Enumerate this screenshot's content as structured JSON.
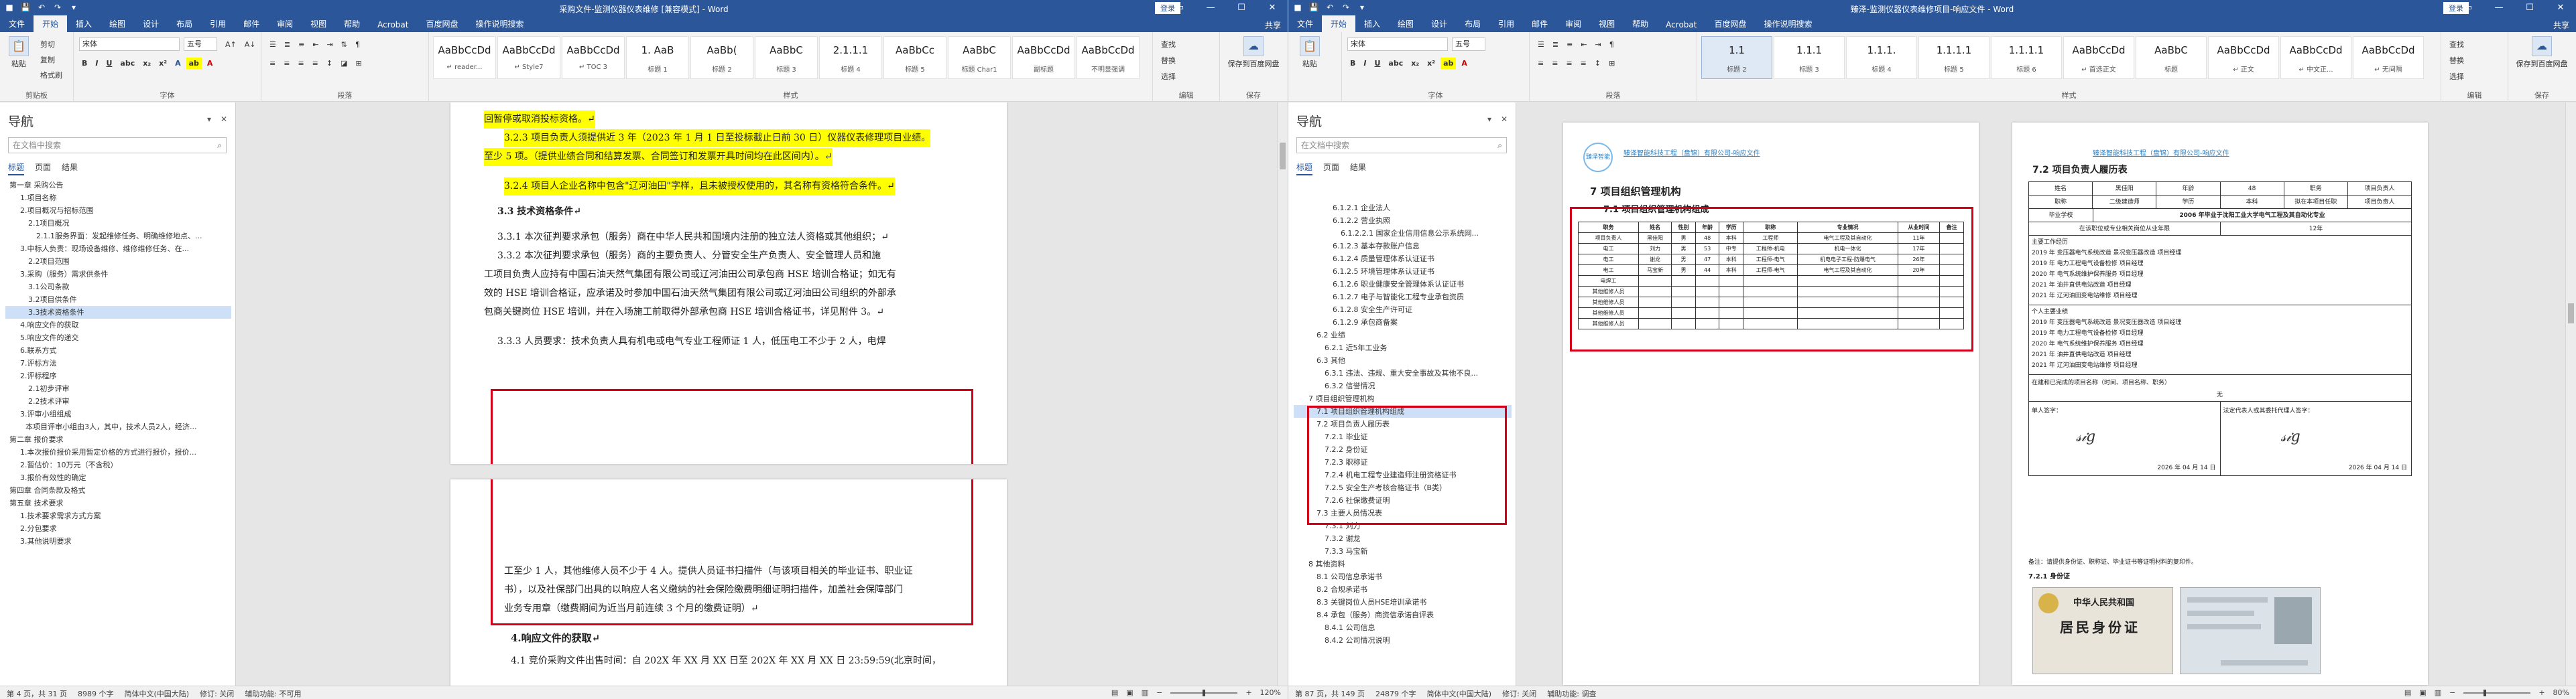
{
  "colors": {
    "word_blue": "#2b579a",
    "highlight": "#ffff00",
    "annotation_red": "#d4001a"
  },
  "left": {
    "title": "采购文件-监测仪器仪表维修 [兼容模式] - Word",
    "login": "登录",
    "share": "共享",
    "tabs": [
      "文件",
      "开始",
      "插入",
      "绘图",
      "设计",
      "布局",
      "引用",
      "邮件",
      "审阅",
      "视图",
      "帮助",
      "Acrobat",
      "百度网盘",
      "操作说明搜索"
    ],
    "ribbon": {
      "paste": "粘贴",
      "cut": "剪切",
      "copy": "复制",
      "format_painter": "格式刷",
      "clipboard": "剪贴板",
      "font_name": "宋体",
      "font_size": "五号",
      "font": "字体",
      "paragraph": "段落",
      "styles_label": "样式",
      "find": "查找",
      "replace": "替换",
      "select": "选择",
      "editing": "编辑",
      "save_baidu": "保存到百度网盘",
      "save_group": "保存",
      "styles": [
        {
          "prev": "AaBbCcDd",
          "name": "↵ reader..."
        },
        {
          "prev": "AaBbCcDd",
          "name": "↵ Style7"
        },
        {
          "prev": "AaBbCcDd",
          "name": "↵ TOC 3"
        },
        {
          "prev": "1. AaB",
          "name": "标题 1"
        },
        {
          "prev": "AaBb(",
          "name": "标题 2"
        },
        {
          "prev": "AaBbC",
          "name": "标题 3"
        },
        {
          "prev": "2.1.1.1",
          "name": "标题 4"
        },
        {
          "prev": "AaBbCc",
          "name": "标题 5"
        },
        {
          "prev": "AaBbC",
          "name": "标题 Char1"
        },
        {
          "prev": "AaBbCcDd",
          "name": "副标题"
        },
        {
          "prev": "AaBbCcDd",
          "name": "不明显强调"
        }
      ]
    },
    "nav": {
      "title": "导航",
      "search_placeholder": "在文档中搜索",
      "tabs": [
        "标题",
        "页面",
        "结果"
      ],
      "items": [
        "第一章 采购公告",
        "1.项目名称",
        "2.项目概况与招标范围",
        "2.1项目概况",
        "2.1.1服务界面：发起维修任务、明确维修地点、...",
        "3.中标人负责：现场设备维修、维修维修任务、在...",
        "2.2项目范围",
        "3.采购（服务）需求供条件",
        "3.1公司条款",
        "3.2项目供条件",
        "3.3技术资格条件",
        "4.响应文件的获取",
        "5.响应文件的递交",
        "6.联系方式",
        "7.评标方法",
        "2.评标程序",
        "2.1初步评审",
        "2.2技术评审",
        "3.评审小组组成",
        "本项目评审小组由3人，其中，技术人员2人，经济...",
        "第二章 报价要求",
        "1.本次报价报价采用暂定价格的方式进行报价，报价...",
        "2.暂估价：10万元（不含税）",
        "3.报价有效性的确定",
        "第四章 合同条款及格式",
        "第五章 技术要求",
        "1.技术要求需求方式方案",
        "2.分包要求",
        "3.其他说明要求"
      ]
    },
    "doc": {
      "lines": [
        "回暂停或取消投标资格。↵",
        "3.2.3 项目负责人须提供近 3 年（2023 年 1 月 1 日至投标截止日前 30 日）仪器仪表修理项目业绩。",
        "至少 5 项。（提供业绩合同和结算发票、合同签订和发票开具时间均在此区间内）。↵",
        "3.2.4 项目人企业名称中包含\"辽河油田\"字样，且未被授权使用的，其名称有资格符合条件。↵",
        "3.3 技术资格条件↵",
        "3.3.1 本次征判要求承包（服务）商在中华人民共和国境内注册的独立法人资格或其他组织；↵",
        "3.3.2 本次征判要求承包（服务）商的主要负责人、分管安全生产负责人、安全管理人员和施",
        "工项目负责人应持有中国石油天然气集团有限公司或辽河油田公司承包商 HSE 培训合格证；如无有",
        "效的 HSE 培训合格证，应承诺及时参加中国石油天然气集团有限公司或辽河油田公司组织的外部承",
        "包商关键岗位 HSE 培训，并在入场施工前取得外部承包商 HSE 培训合格证书，详见附件 3。↵",
        "3.3.3 人员要求：技术负责人具有机电或电气专业工程师证 1 人，低压电工不少于 2 人，电焊"
      ],
      "lines2": [
        "工至少 1 人，其他维修人员不少于 4 人。提供人员证书扫描件（与该项目相关的毕业证书、职业证",
        "书），以及社保部门出具的以响应人名义缴纳的社会保险缴费明细证明扫描件，加盖社会保障部门",
        "业务专用章（缴费期间为近当月前连续 3 个月的缴费证明）↵",
        "4.响应文件的获取↵",
        "4.1 竞价采购文件出售时间：自 202X 年 XX 月 XX 日至 202X 年 XX 月 XX 日 23:59:59(北京时间，"
      ]
    },
    "status": {
      "page": "第 4 页，共 31 页",
      "words": "8989 个字",
      "lang": "简体中文(中国大陆)",
      "track": "修订: 关闭",
      "access": "辅助功能: 不可用",
      "zoom": "120%"
    }
  },
  "right": {
    "title": "臻泽-监测仪器仪表维修项目-响应文件 - Word",
    "login": "登录",
    "share": "共享",
    "tabs": [
      "文件",
      "开始",
      "插入",
      "绘图",
      "设计",
      "布局",
      "引用",
      "邮件",
      "审阅",
      "视图",
      "帮助",
      "Acrobat",
      "百度网盘",
      "操作说明搜索"
    ],
    "ribbon": {
      "paste": "粘贴",
      "font_name": "宋体",
      "font_size": "五号",
      "font": "字体",
      "paragraph": "段落",
      "styles_label": "样式",
      "find": "查找",
      "replace": "替换",
      "select": "选择",
      "editing": "编辑",
      "save_baidu": "保存到百度网盘",
      "save_group": "保存",
      "styles": [
        {
          "prev": "1.1",
          "name": "标题 2"
        },
        {
          "prev": "1.1.1",
          "name": "标题 3"
        },
        {
          "prev": "1.1.1.",
          "name": "标题 4"
        },
        {
          "prev": "1.1.1.1",
          "name": "标题 5"
        },
        {
          "prev": "1.1.1.1",
          "name": "标题 6"
        },
        {
          "prev": "AaBbCcDd",
          "name": "↵ 首选正文"
        },
        {
          "prev": "AaBbC",
          "name": "标题"
        },
        {
          "prev": "AaBbCcDd",
          "name": "↵ 正文"
        },
        {
          "prev": "AaBbCcDd",
          "name": "↵ 中文正..."
        },
        {
          "prev": "AaBbCcDd",
          "name": "↵ 无间隔"
        }
      ]
    },
    "nav": {
      "title": "导航",
      "search_placeholder": "在文档中搜索",
      "tabs": [
        "标题",
        "页面",
        "结果"
      ],
      "items": [
        "6.1.2.1 企业法人",
        "6.1.2.2 营业执照",
        "6.1.2.2.1 国家企业信用信息公示系统网...",
        "6.1.2.3 基本存款账户信息",
        "6.1.2.4 质量管理体系认证证书",
        "6.1.2.5 环境管理体系认证证书",
        "6.1.2.6 职业健康安全管理体系认证证书",
        "6.1.2.7 电子与智能化工程专业承包资质",
        "6.1.2.8 安全生产许可证",
        "6.1.2.9 承包商备案",
        "6.2 业绩",
        "6.2.1 近5年工业务",
        "6.3 其他",
        "6.3.1 违法、违规、重大安全事故及其他不良...",
        "6.3.2 信誉情况",
        "7 项目组织管理机构",
        "7.1 项目组织管理机构组成",
        "7.2 项目负责人履历表",
        "7.2.1 毕业证",
        "7.2.2 身份证",
        "7.2.3 职称证",
        "7.2.4 机电工程专业建造师注册资格证书",
        "7.2.5 安全生产考核合格证书（B类）",
        "7.2.6 社保缴费证明",
        "7.3 主要人员情况表",
        "7.3.1 刘力",
        "7.3.2 谢龙",
        "7.3.3 马宝新",
        "8 其他资料",
        "8.1 公司信息承诺书",
        "8.2 合规承诺书",
        "8.3 关键岗位人员HSE培训承诺书",
        "8.4 承包（服务）商资信承诺自评表",
        "8.4.1 公司信息",
        "8.4.2 公司情况说明"
      ]
    },
    "page1": {
      "header": "臻泽智能科技工程（盘锦）有限公司-响应文件",
      "h7": "7  项目组织管理机构",
      "h71": "7.1  项目组织管理机构组成",
      "table_headers": [
        "职务",
        "姓名",
        "性别",
        "年龄",
        "学历",
        "职称",
        "专业情况",
        "从业时间",
        "备注"
      ],
      "rows": [
        [
          "项目负责人",
          "黑佳阳",
          "男",
          "48",
          "本科",
          "工程师",
          "电气工程及其自动化",
          "11年",
          ""
        ],
        [
          "电工",
          "刘力",
          "男",
          "53",
          "中专",
          "工程师-机电",
          "机电一体化",
          "17年",
          ""
        ],
        [
          "电工",
          "谢龙",
          "男",
          "47",
          "本科",
          "工程师-电气",
          "机电电子工程-防爆电气",
          "26年",
          ""
        ],
        [
          "电工",
          "马宝新",
          "男",
          "44",
          "本科",
          "工程师-电气",
          "电气工程及其自动化",
          "20年",
          ""
        ],
        [
          "电焊工",
          "",
          "",
          "",
          "",
          "",
          "",
          "",
          ""
        ],
        [
          "其他维修人员",
          "",
          "",
          "",
          "",
          "",
          "",
          "",
          ""
        ],
        [
          "其他维修人员",
          "",
          "",
          "",
          "",
          "",
          "",
          "",
          ""
        ],
        [
          "其他维修人员",
          "",
          "",
          "",
          "",
          "",
          "",
          "",
          ""
        ],
        [
          "其他维修人员",
          "",
          "",
          "",
          "",
          "",
          "",
          "",
          ""
        ]
      ],
      "logo_text": "臻泽智能"
    },
    "page2": {
      "header": "臻泽智能科技工程（盘锦）有限公司-响应文件",
      "h72": "7.2  项目负责人履历表",
      "r1": [
        "姓名",
        "黑佳阳",
        "年龄",
        "48",
        "职务",
        "项目负责人"
      ],
      "r2": [
        "职称",
        "二级建造师",
        "学历",
        "本科",
        "拟在本项目任职",
        "项目负责人"
      ],
      "grad_label": "毕业学校",
      "grad_value": "2006 年毕业于沈阳工业大学电气工程及其自动化专业",
      "years_label": "在该职位或专业相关岗位从业年限",
      "years_value": "12年",
      "work_label": "主要工作经历",
      "work": [
        "2019 年 变压器电气系统改造 景况变压器改造 项目经理",
        "2019 年 电力工程电气设备检修 项目经理",
        "2020 年 电气系统维护保养服务 项目经理",
        "2021 年 油井直供电站改造 项目经理",
        "2021 年 辽河油田变电站维修 项目经理"
      ],
      "perf_label": "个人主要业绩",
      "perf": [
        "2019 年 变压器电气系统改造 景况变压器改造 项目经理",
        "2019 年 电力工程电气设备检修 项目经理",
        "2020 年 电气系统维护保养服务 项目经理",
        "2021 年 油井直供电站改造 项目经理",
        "2021 年 辽河油田变电站维修 项目经理"
      ],
      "project_label": "在建和已完成的项目名称（时间、项目名称、职务）",
      "none": "无",
      "sign1": "单人签字：",
      "sign2": "法定代表人或其委托代理人签字：",
      "date1": "2026 年 04 月 14 日",
      "date2": "2026 年 04 月 14 日",
      "note": "备注：请提供身份证、职称证、毕业证书等证明材料的复印件。",
      "h721": "7.2.1  身份证",
      "id_country": "中华人民共和国",
      "id_title": "居民身份证"
    },
    "status": {
      "page": "第 87 页，共 149 页",
      "words": "24879 个字",
      "lang": "简体中文(中国大陆)",
      "track": "修订: 关闭",
      "access": "辅助功能: 调查",
      "zoom": "80%"
    }
  }
}
